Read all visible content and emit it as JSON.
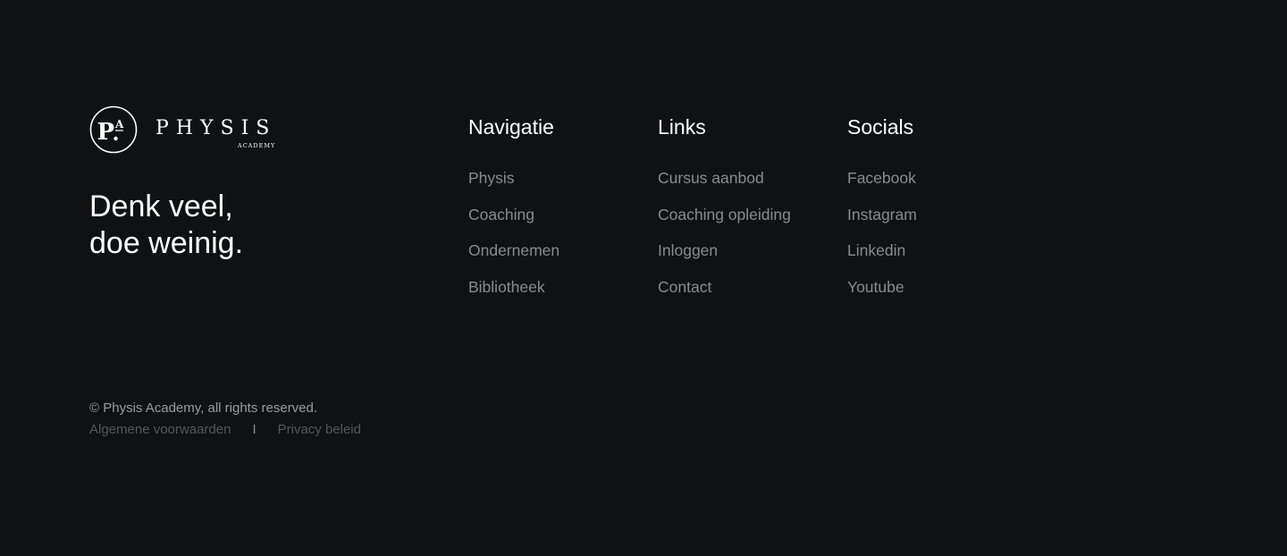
{
  "brand": {
    "wordmark": "PHYSIS",
    "sub": "ACADEMY",
    "monogram_main": "P",
    "monogram_small": "A"
  },
  "tagline": {
    "line1": "Denk veel,",
    "line2": "doe weinig."
  },
  "columns": {
    "navigatie": {
      "title": "Navigatie",
      "items": [
        "Physis",
        "Coaching",
        "Ondernemen",
        "Bibliotheek"
      ]
    },
    "links": {
      "title": "Links",
      "items": [
        "Cursus aanbod",
        "Coaching opleiding",
        "Inloggen",
        "Contact"
      ]
    },
    "socials": {
      "title": "Socials",
      "items": [
        "Facebook",
        "Instagram",
        "Linkedin",
        "Youtube"
      ]
    }
  },
  "legal": {
    "copyright": "© Physis Academy, all rights reserved.",
    "terms": "Algemene voorwaarden",
    "separator": "I",
    "privacy": "Privacy beleid"
  },
  "colors": {
    "background": "#101113",
    "heading": "#ffffff",
    "link": "#8a8b8e",
    "muted": "#55565a"
  },
  "icons": {
    "logo": "pa-monogram-circle-icon"
  }
}
